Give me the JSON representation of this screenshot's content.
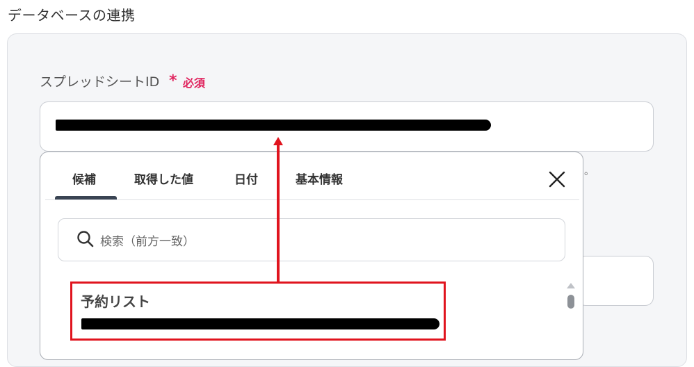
{
  "header": {
    "title": "データベースの連携"
  },
  "field": {
    "label": "スプレッドシートID",
    "required_star": "*",
    "required_text": "必須",
    "hint_tail": "。"
  },
  "popup": {
    "tabs": [
      {
        "label": "候補",
        "active": true
      },
      {
        "label": "取得した値",
        "active": false
      },
      {
        "label": "日付",
        "active": false
      },
      {
        "label": "基本情報",
        "active": false
      }
    ],
    "close_icon": "close-icon",
    "search": {
      "placeholder": "検索（前方一致）",
      "icon": "search-icon"
    },
    "list": [
      {
        "title": "予約リスト"
      }
    ]
  },
  "colors": {
    "accent": "#e0141e",
    "required": "#e0245e"
  }
}
